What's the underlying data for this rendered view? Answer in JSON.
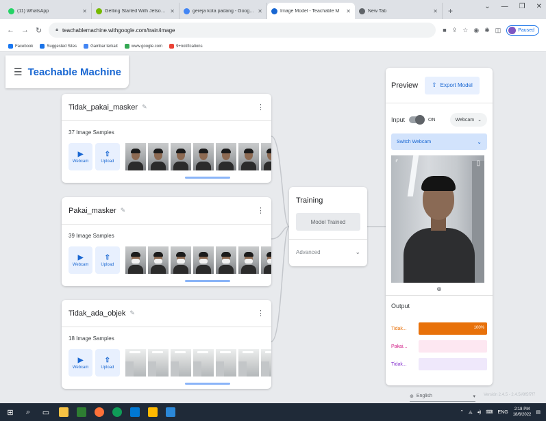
{
  "browser": {
    "tabs": [
      {
        "title": "(11) WhatsApp",
        "color": "#25d366",
        "active": false
      },
      {
        "title": "Getting Started With Jetson Nan",
        "color": "#76b900",
        "active": false
      },
      {
        "title": "gereja kota padang - Google Se",
        "color": "#4285f4",
        "active": false
      },
      {
        "title": "Image Model - Teachable M",
        "color": "#1967d2",
        "active": true
      },
      {
        "title": "New Tab",
        "color": "#5f6368",
        "active": false
      }
    ],
    "url": "teachablemachine.withgoogle.com/train/image",
    "profile_label": "Paused",
    "bookmarks": [
      {
        "label": "Facebook",
        "color": "#1877f2"
      },
      {
        "label": "Suggested Sites",
        "color": "#1a73e8"
      },
      {
        "label": "Gambar terkait",
        "color": "#4285f4"
      },
      {
        "label": "www.google.com",
        "color": "#34a853"
      },
      {
        "label": "9+notifications",
        "color": "#ea4335"
      }
    ]
  },
  "app": {
    "title": "Teachable Machine"
  },
  "classes": [
    {
      "name": "Tidak_pakai_masker",
      "samples": "37 Image Samples",
      "webcam_label": "Webcam",
      "upload_label": "Upload",
      "thumb_type": "nomask"
    },
    {
      "name": "Pakai_masker",
      "samples": "39 Image Samples",
      "webcam_label": "Webcam",
      "upload_label": "Upload",
      "thumb_type": "mask"
    },
    {
      "name": "Tidak_ada_objek",
      "samples": "18 Image Samples",
      "webcam_label": "Webcam",
      "upload_label": "Upload",
      "thumb_type": "room"
    }
  ],
  "training": {
    "title": "Training",
    "button_label": "Model Trained",
    "advanced_label": "Advanced"
  },
  "preview": {
    "title": "Preview",
    "export_label": "Export Model",
    "input_label": "Input",
    "toggle_state": "ON",
    "source_label": "Webcam",
    "switch_label": "Switch Webcam",
    "output_label": "Output",
    "outputs": [
      {
        "label": "Tidak...",
        "percent": 100,
        "percent_label": "100%",
        "color": "#e8710a",
        "track": "#fce8d6"
      },
      {
        "label": "Pakai...",
        "percent": 0,
        "percent_label": "",
        "color": "#d01884",
        "track": "#fde7f1"
      },
      {
        "label": "Tidak...",
        "percent": 0,
        "percent_label": "",
        "color": "#8430ce",
        "track": "#efe8fb"
      }
    ]
  },
  "footer": {
    "language": "English",
    "version": "Versión 2.4.5 - 2.4.5#9f5f7f7"
  },
  "taskbar": {
    "lang": "ENG",
    "time": "2:18 PM",
    "date": "18/6/2022"
  }
}
